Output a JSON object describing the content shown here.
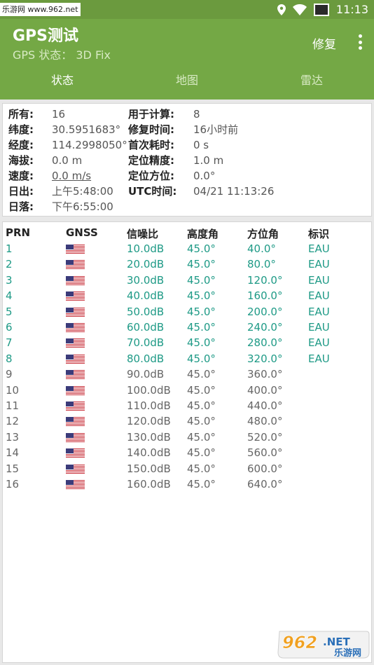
{
  "status_bar": {
    "watermark": "乐游网 www.962.net",
    "time": "11:13"
  },
  "app_bar": {
    "title": "GPS测试",
    "subtitle": "GPS 状态：  3D Fix",
    "fix_action": "修复"
  },
  "tabs": [
    {
      "label": "状态",
      "active": true
    },
    {
      "label": "地图",
      "active": false
    },
    {
      "label": "雷达",
      "active": false
    }
  ],
  "info": {
    "in_view_label": "所有:",
    "in_view_value": "16",
    "in_use_label": "用于计算:",
    "in_use_value": "8",
    "lat_label": "纬度:",
    "lat_value": "30.5951683°",
    "fix_time_label": "修复时间:",
    "fix_time_value": "16小时前",
    "lon_label": "经度:",
    "lon_value": "114.2998050°",
    "ttff_label": "首次耗时:",
    "ttff_value": "0 s",
    "alt_label": "海拔:",
    "alt_value": "0.0 m",
    "accuracy_label": "定位精度:",
    "accuracy_value": "1.0 m",
    "speed_label": "速度:",
    "speed_value": "0.0 m/s",
    "bearing_label": "定位方位:",
    "bearing_value": "0.0°",
    "sunrise_label": "日出:",
    "sunrise_value": "上午5:48:00",
    "utc_label": "UTC时间:",
    "utc_value": "04/21 11:13:26",
    "sunset_label": "日落:",
    "sunset_value": "下午6:55:00"
  },
  "sat_table": {
    "headers": [
      "PRN",
      "GNSS",
      "信噪比",
      "高度角",
      "方位角",
      "标识"
    ],
    "rows": [
      {
        "prn": "1",
        "snr": "10.0dB",
        "elev": "45.0°",
        "azim": "40.0°",
        "flags": "EAU",
        "used": true
      },
      {
        "prn": "2",
        "snr": "20.0dB",
        "elev": "45.0°",
        "azim": "80.0°",
        "flags": "EAU",
        "used": true
      },
      {
        "prn": "3",
        "snr": "30.0dB",
        "elev": "45.0°",
        "azim": "120.0°",
        "flags": "EAU",
        "used": true
      },
      {
        "prn": "4",
        "snr": "40.0dB",
        "elev": "45.0°",
        "azim": "160.0°",
        "flags": "EAU",
        "used": true
      },
      {
        "prn": "5",
        "snr": "50.0dB",
        "elev": "45.0°",
        "azim": "200.0°",
        "flags": "EAU",
        "used": true
      },
      {
        "prn": "6",
        "snr": "60.0dB",
        "elev": "45.0°",
        "azim": "240.0°",
        "flags": "EAU",
        "used": true
      },
      {
        "prn": "7",
        "snr": "70.0dB",
        "elev": "45.0°",
        "azim": "280.0°",
        "flags": "EAU",
        "used": true
      },
      {
        "prn": "8",
        "snr": "80.0dB",
        "elev": "45.0°",
        "azim": "320.0°",
        "flags": "EAU",
        "used": true
      },
      {
        "prn": "9",
        "snr": "90.0dB",
        "elev": "45.0°",
        "azim": "360.0°",
        "flags": "",
        "used": false
      },
      {
        "prn": "10",
        "snr": "100.0dB",
        "elev": "45.0°",
        "azim": "400.0°",
        "flags": "",
        "used": false
      },
      {
        "prn": "11",
        "snr": "110.0dB",
        "elev": "45.0°",
        "azim": "440.0°",
        "flags": "",
        "used": false
      },
      {
        "prn": "12",
        "snr": "120.0dB",
        "elev": "45.0°",
        "azim": "480.0°",
        "flags": "",
        "used": false
      },
      {
        "prn": "13",
        "snr": "130.0dB",
        "elev": "45.0°",
        "azim": "520.0°",
        "flags": "",
        "used": false
      },
      {
        "prn": "14",
        "snr": "140.0dB",
        "elev": "45.0°",
        "azim": "560.0°",
        "flags": "",
        "used": false
      },
      {
        "prn": "15",
        "snr": "150.0dB",
        "elev": "45.0°",
        "azim": "600.0°",
        "flags": "",
        "used": false
      },
      {
        "prn": "16",
        "snr": "160.0dB",
        "elev": "45.0°",
        "azim": "640.0°",
        "flags": "",
        "used": false
      }
    ]
  },
  "gnss_icon": "us-flag-icon",
  "watermark_logo": {
    "brand": "962",
    "suffix": ".NET",
    "caption": "乐游网"
  },
  "colors": {
    "primary": "#74a845",
    "status_bar": "#6b9a3e",
    "used_text": "#1e9a86",
    "unused_text": "#666666"
  }
}
